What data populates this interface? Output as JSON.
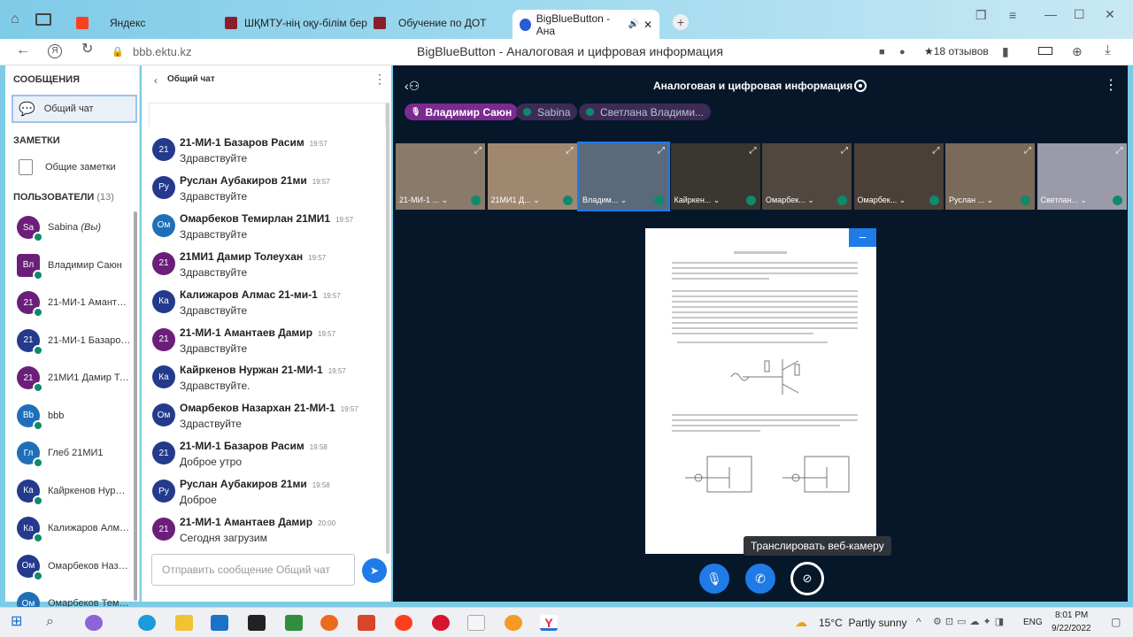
{
  "browser": {
    "tabs": [
      {
        "label": "Яндекс",
        "color": "#fc3f1d"
      },
      {
        "label": "ШҚМТУ-нің оқу-білім бер",
        "color": "#8b1e2d"
      },
      {
        "label": "Обучение по ДОТ",
        "color": "#8b1e2d"
      },
      {
        "label": "BigBlueButton - Ана",
        "color": "#2a5bd7"
      }
    ],
    "url": "bbb.ektu.kz",
    "page_title": "BigBlueButton - Аналоговая и цифровая информация",
    "reviews": "18 отзывов"
  },
  "sidebar": {
    "messages_header": "СООБЩЕНИЯ",
    "public_chat": "Общий чат",
    "notes_header": "ЗАМЕТКИ",
    "shared_notes": "Общие заметки",
    "users_header": "ПОЛЬЗОВАТЕЛИ",
    "users_count": "(13)",
    "users": [
      {
        "initials": "Sa",
        "name": "Sabina",
        "suffix": "(Вы)",
        "color": "#6b1f7a"
      },
      {
        "initials": "Вл",
        "name": "Владимир Саюн",
        "color": "#6b1f7a",
        "square": true
      },
      {
        "initials": "21",
        "name": "21-МИ-1 Амантае...",
        "color": "#6b1f7a"
      },
      {
        "initials": "21",
        "name": "21-МИ-1 Базаров ...",
        "color": "#243a8c"
      },
      {
        "initials": "21",
        "name": "21МИ1 Дамир Тол...",
        "color": "#6b1f7a"
      },
      {
        "initials": "Bb",
        "name": "bbb",
        "color": "#1f6fb8"
      },
      {
        "initials": "Гл",
        "name": "Глеб 21МИ1",
        "color": "#1f6fb8"
      },
      {
        "initials": "Ка",
        "name": "Кайркенов Нуржа...",
        "color": "#243a8c"
      },
      {
        "initials": "Ка",
        "name": "Калижаров Алма...",
        "color": "#243a8c"
      },
      {
        "initials": "Ом",
        "name": "Омарбеков Назар...",
        "color": "#243a8c"
      },
      {
        "initials": "Ом",
        "name": "Омарбеков Теми...",
        "color": "#1f6fb8"
      }
    ]
  },
  "chat": {
    "title": "Общий чат",
    "placeholder": "Отправить сообщение Общий чат",
    "messages": [
      {
        "initials": "21",
        "name": "21-МИ-1 Базаров Расим",
        "time": "19:57",
        "text": "Здравствуйте",
        "color": "#243a8c"
      },
      {
        "initials": "Ру",
        "name": "Руслан Аубакиров 21ми",
        "time": "19:57",
        "text": "Здравствуйте",
        "color": "#243a8c"
      },
      {
        "initials": "Ом",
        "name": "Омарбеков Темирлан 21МИ1",
        "time": "19:57",
        "text": "Здравствуйте",
        "color": "#1f6fb8"
      },
      {
        "initials": "21",
        "name": "21МИ1 Дамир Толеухан",
        "time": "19:57",
        "text": "Здравствуйте",
        "color": "#6b1f7a"
      },
      {
        "initials": "Ка",
        "name": "Калижаров Алмас 21-ми-1",
        "time": "19:57",
        "text": "Здравствуйте",
        "color": "#243a8c"
      },
      {
        "initials": "21",
        "name": "21-МИ-1 Амантаев Дамир",
        "time": "19:57",
        "text": "Здравствуйте",
        "color": "#6b1f7a"
      },
      {
        "initials": "Ка",
        "name": "Кайркенов Нуржан 21-МИ-1",
        "time": "19:57",
        "text": "Здравствуйте.",
        "color": "#243a8c"
      },
      {
        "initials": "Ом",
        "name": "Омарбеков Назархан 21-МИ-1",
        "time": "19:57",
        "text": "Здраствуйте",
        "color": "#243a8c"
      },
      {
        "initials": "21",
        "name": "21-МИ-1 Базаров Расим",
        "time": "19:58",
        "text": "Доброе утро",
        "color": "#243a8c"
      },
      {
        "initials": "Ру",
        "name": "Руслан Аубакиров 21ми",
        "time": "19:58",
        "text": "Доброе",
        "color": "#243a8c"
      },
      {
        "initials": "21",
        "name": "21-МИ-1 Амантаев Дамир",
        "time": "20:00",
        "text": "Сегодня загрузим",
        "color": "#6b1f7a"
      }
    ]
  },
  "meeting": {
    "title": "Аналоговая и цифровая информация",
    "talkers": [
      "Владимир Саюн",
      "Sabina",
      "Светлана Владими..."
    ],
    "videos": [
      "21-МИ-1 ...",
      "21МИ1 Д...",
      "Владим...",
      "Кайркен...",
      "Омарбек...",
      "Омарбек...",
      "Руслан ...",
      "Светлан..."
    ],
    "tooltip": "Транслировать веб-камеру"
  },
  "taskbar": {
    "weather": "15°C  Partly sunny",
    "lang": "ENG",
    "time": "8:01 PM",
    "date": "9/22/2022"
  }
}
